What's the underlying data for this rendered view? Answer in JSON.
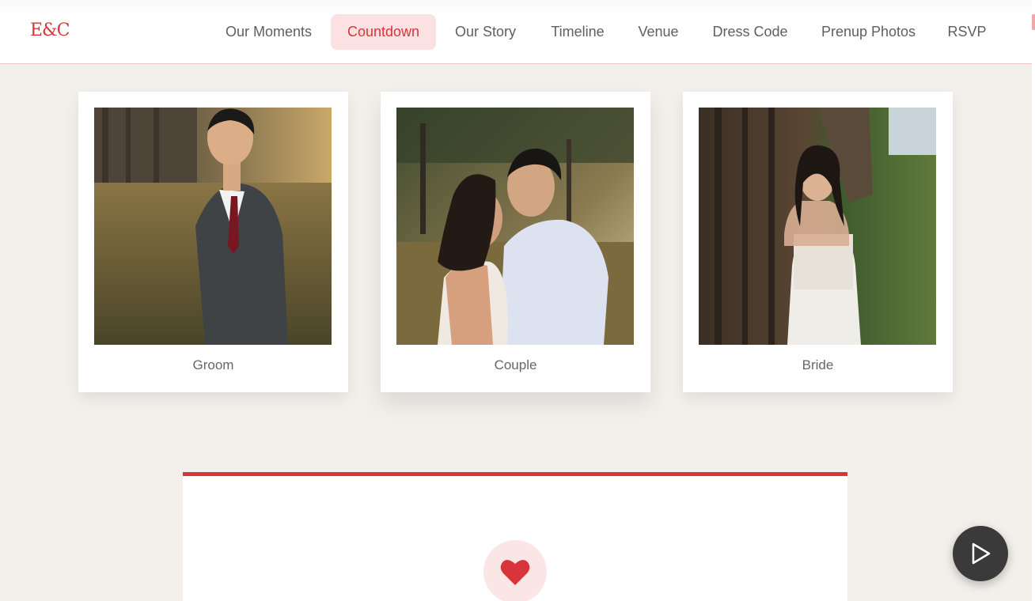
{
  "brand": {
    "logo_text": "E&C",
    "accent_color": "#d7343b"
  },
  "nav": {
    "items": [
      {
        "label": "Our Moments"
      },
      {
        "label": "Countdown",
        "active": true
      },
      {
        "label": "Our Story"
      },
      {
        "label": "Timeline"
      },
      {
        "label": "Venue"
      },
      {
        "label": "Dress Code"
      },
      {
        "label": "Prenup Photos"
      },
      {
        "label": "RSVP"
      }
    ]
  },
  "photos": [
    {
      "caption": "Groom",
      "image": "groom-portrait"
    },
    {
      "caption": "Couple",
      "image": "couple-portrait"
    },
    {
      "caption": "Bride",
      "image": "bride-portrait"
    }
  ],
  "countdown_panel": {
    "icon": "heart-icon",
    "border_color": "#d7343b"
  },
  "player": {
    "icon": "play-icon"
  }
}
